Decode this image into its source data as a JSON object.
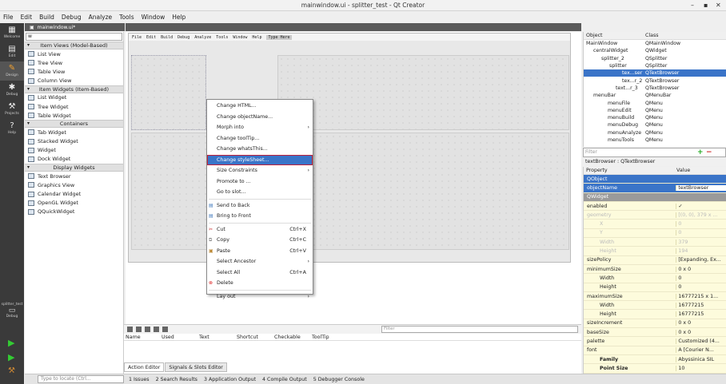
{
  "window": {
    "title": "mainwindow.ui - splitter_test - Qt Creator"
  },
  "menubar": [
    "File",
    "Edit",
    "Build",
    "Debug",
    "Analyze",
    "Tools",
    "Window",
    "Help"
  ],
  "modes": [
    {
      "label": "Welcome",
      "icon": "grid-icon"
    },
    {
      "label": "Edit",
      "icon": "document-icon"
    },
    {
      "label": "Design",
      "icon": "pencil-icon"
    },
    {
      "label": "Debug",
      "icon": "bug-icon"
    },
    {
      "label": "Projects",
      "icon": "wrench-icon"
    },
    {
      "label": "Help",
      "icon": "help-icon"
    }
  ],
  "kit": {
    "label": "splitter_test",
    "sub": "Debug"
  },
  "editor_tab": "mainwindow.ui*",
  "widgetbox": {
    "filter": "w",
    "groups": [
      {
        "title": "Item Views (Model-Based)",
        "items": [
          "List View",
          "Tree View",
          "Table View",
          "Column View"
        ]
      },
      {
        "title": "Item Widgets (Item-Based)",
        "items": [
          "List Widget",
          "Tree Widget",
          "Table Widget"
        ]
      },
      {
        "title": "Containers",
        "items": [
          "Tab Widget",
          "Stacked Widget",
          "Widget",
          "Dock Widget"
        ]
      },
      {
        "title": "Display Widgets",
        "items": [
          "Text Browser",
          "Graphics View",
          "Calendar Widget",
          "OpenGL Widget",
          "QQuickWidget"
        ]
      }
    ]
  },
  "form_menu": [
    "File",
    "Edit",
    "Build",
    "Debug",
    "Analyze",
    "Tools",
    "Window",
    "Help",
    "Type Here"
  ],
  "context_menu": [
    {
      "label": "Change HTML..."
    },
    {
      "label": "Change objectName..."
    },
    {
      "label": "Morph into",
      "sub": true
    },
    {
      "label": "Change toolTip..."
    },
    {
      "label": "Change whatsThis..."
    },
    {
      "label": "Change styleSheet...",
      "selected": true
    },
    {
      "label": "Size Constraints",
      "sub": true
    },
    {
      "label": "Promote to ..."
    },
    {
      "label": "Go to slot..."
    },
    {
      "label": "Send to Back",
      "icon": "send-back-icon"
    },
    {
      "label": "Bring to Front",
      "icon": "bring-front-icon"
    },
    {
      "label": "Cut",
      "shortcut": "Ctrl+X",
      "icon": "scissors-icon"
    },
    {
      "label": "Copy",
      "shortcut": "Ctrl+C",
      "icon": "copy-icon"
    },
    {
      "label": "Paste",
      "shortcut": "Ctrl+V",
      "icon": "paste-icon"
    },
    {
      "label": "Select Ancestor",
      "sub": true
    },
    {
      "label": "Select All",
      "shortcut": "Ctrl+A"
    },
    {
      "label": "Delete",
      "icon": "delete-icon"
    },
    {
      "label": "Lay out",
      "sub": true
    }
  ],
  "action_editor": {
    "filter_placeholder": "Filter",
    "columns": [
      "Name",
      "Used",
      "Text",
      "Shortcut",
      "Checkable",
      "ToolTip"
    ],
    "tabs": [
      "Action Editor",
      "Signals & Slots Editor"
    ]
  },
  "bottombar": {
    "locator_placeholder": "Type to locate (Ctrl...",
    "panes": [
      "1 Issues",
      "2 Search Results",
      "3 Application Output",
      "4 Compile Output",
      "5 Debugger Console"
    ]
  },
  "object_inspector": {
    "headers": [
      "Object",
      "Class"
    ],
    "rows": [
      {
        "object": "MainWindow",
        "class": "QMainWindow"
      },
      {
        "object": "centralWidget",
        "class": "QWidget"
      },
      {
        "object": "splitter_2",
        "class": "QSplitter"
      },
      {
        "object": "splitter",
        "class": "QSplitter"
      },
      {
        "object": "tex...ser",
        "class": "QTextBrowser",
        "selected": true
      },
      {
        "object": "tex...r_2",
        "class": "QTextBrowser"
      },
      {
        "object": "text...r_3",
        "class": "QTextBrowser"
      },
      {
        "object": "menuBar",
        "class": "QMenuBar"
      },
      {
        "object": "menuFile",
        "class": "QMenu"
      },
      {
        "object": "menuEdit",
        "class": "QMenu"
      },
      {
        "object": "menuBuild",
        "class": "QMenu"
      },
      {
        "object": "menuDebug",
        "class": "QMenu"
      },
      {
        "object": "menuAnalyze",
        "class": "QMenu"
      },
      {
        "object": "menuTools",
        "class": "QMenu"
      }
    ],
    "filter_placeholder": "Filter"
  },
  "property_editor": {
    "title": "textBrowser : QTextBrowser",
    "headers": [
      "Property",
      "Value"
    ],
    "rows": [
      {
        "name": "QObject",
        "value": "",
        "kind": "grpsel"
      },
      {
        "name": "objectName",
        "value": "textBrowser",
        "kind": "sel"
      },
      {
        "name": "QWidget",
        "value": "",
        "kind": "grp"
      },
      {
        "name": "enabled",
        "value": "✓",
        "kind": ""
      },
      {
        "name": "geometry",
        "value": "[(0, 0), 379 x ...",
        "kind": "dis"
      },
      {
        "name": "X",
        "value": "0",
        "kind": "dis ind"
      },
      {
        "name": "Y",
        "value": "0",
        "kind": "dis ind"
      },
      {
        "name": "Width",
        "value": "379",
        "kind": "dis ind"
      },
      {
        "name": "Height",
        "value": "194",
        "kind": "dis ind"
      },
      {
        "name": "sizePolicy",
        "value": "[Expanding, Ex...",
        "kind": ""
      },
      {
        "name": "minimumSize",
        "value": "0 x 0",
        "kind": ""
      },
      {
        "name": "Width",
        "value": "0",
        "kind": "ind"
      },
      {
        "name": "Height",
        "value": "0",
        "kind": "ind"
      },
      {
        "name": "maximumSize",
        "value": "16777215 x 1...",
        "kind": ""
      },
      {
        "name": "Width",
        "value": "16777215",
        "kind": "ind"
      },
      {
        "name": "Height",
        "value": "16777215",
        "kind": "ind"
      },
      {
        "name": "sizeIncrement",
        "value": "0 x 0",
        "kind": ""
      },
      {
        "name": "baseSize",
        "value": "0 x 0",
        "kind": ""
      },
      {
        "name": "palette",
        "value": "Customized (4...",
        "kind": ""
      },
      {
        "name": "font",
        "value": "A [Courier N...",
        "kind": ""
      },
      {
        "name": "Family",
        "value": "Abyssinica SIL",
        "kind": "ind bold"
      },
      {
        "name": "Point Size",
        "value": "10",
        "kind": "ind bold"
      }
    ]
  },
  "colors": {
    "accent": "#3a74c8",
    "selection_outline": "#c0203a",
    "sidebar": "#3a3a3a"
  }
}
